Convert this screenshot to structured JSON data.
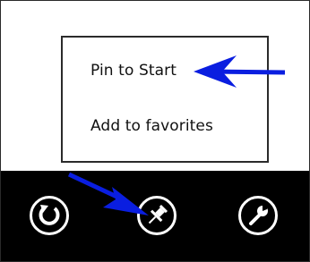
{
  "context_menu": {
    "items": [
      {
        "label": "Pin to Start"
      },
      {
        "label": "Add to favorites"
      }
    ]
  },
  "app_bar": {
    "buttons": [
      {
        "icon": "refresh-icon"
      },
      {
        "icon": "pin-icon"
      },
      {
        "icon": "wrench-icon"
      }
    ]
  },
  "colors": {
    "menu_background": "#ffffff",
    "menu_border": "#2b2b2b",
    "app_bar_background": "#000000",
    "icon_color": "#ffffff",
    "annotation_arrow": "#0a1ee0"
  }
}
